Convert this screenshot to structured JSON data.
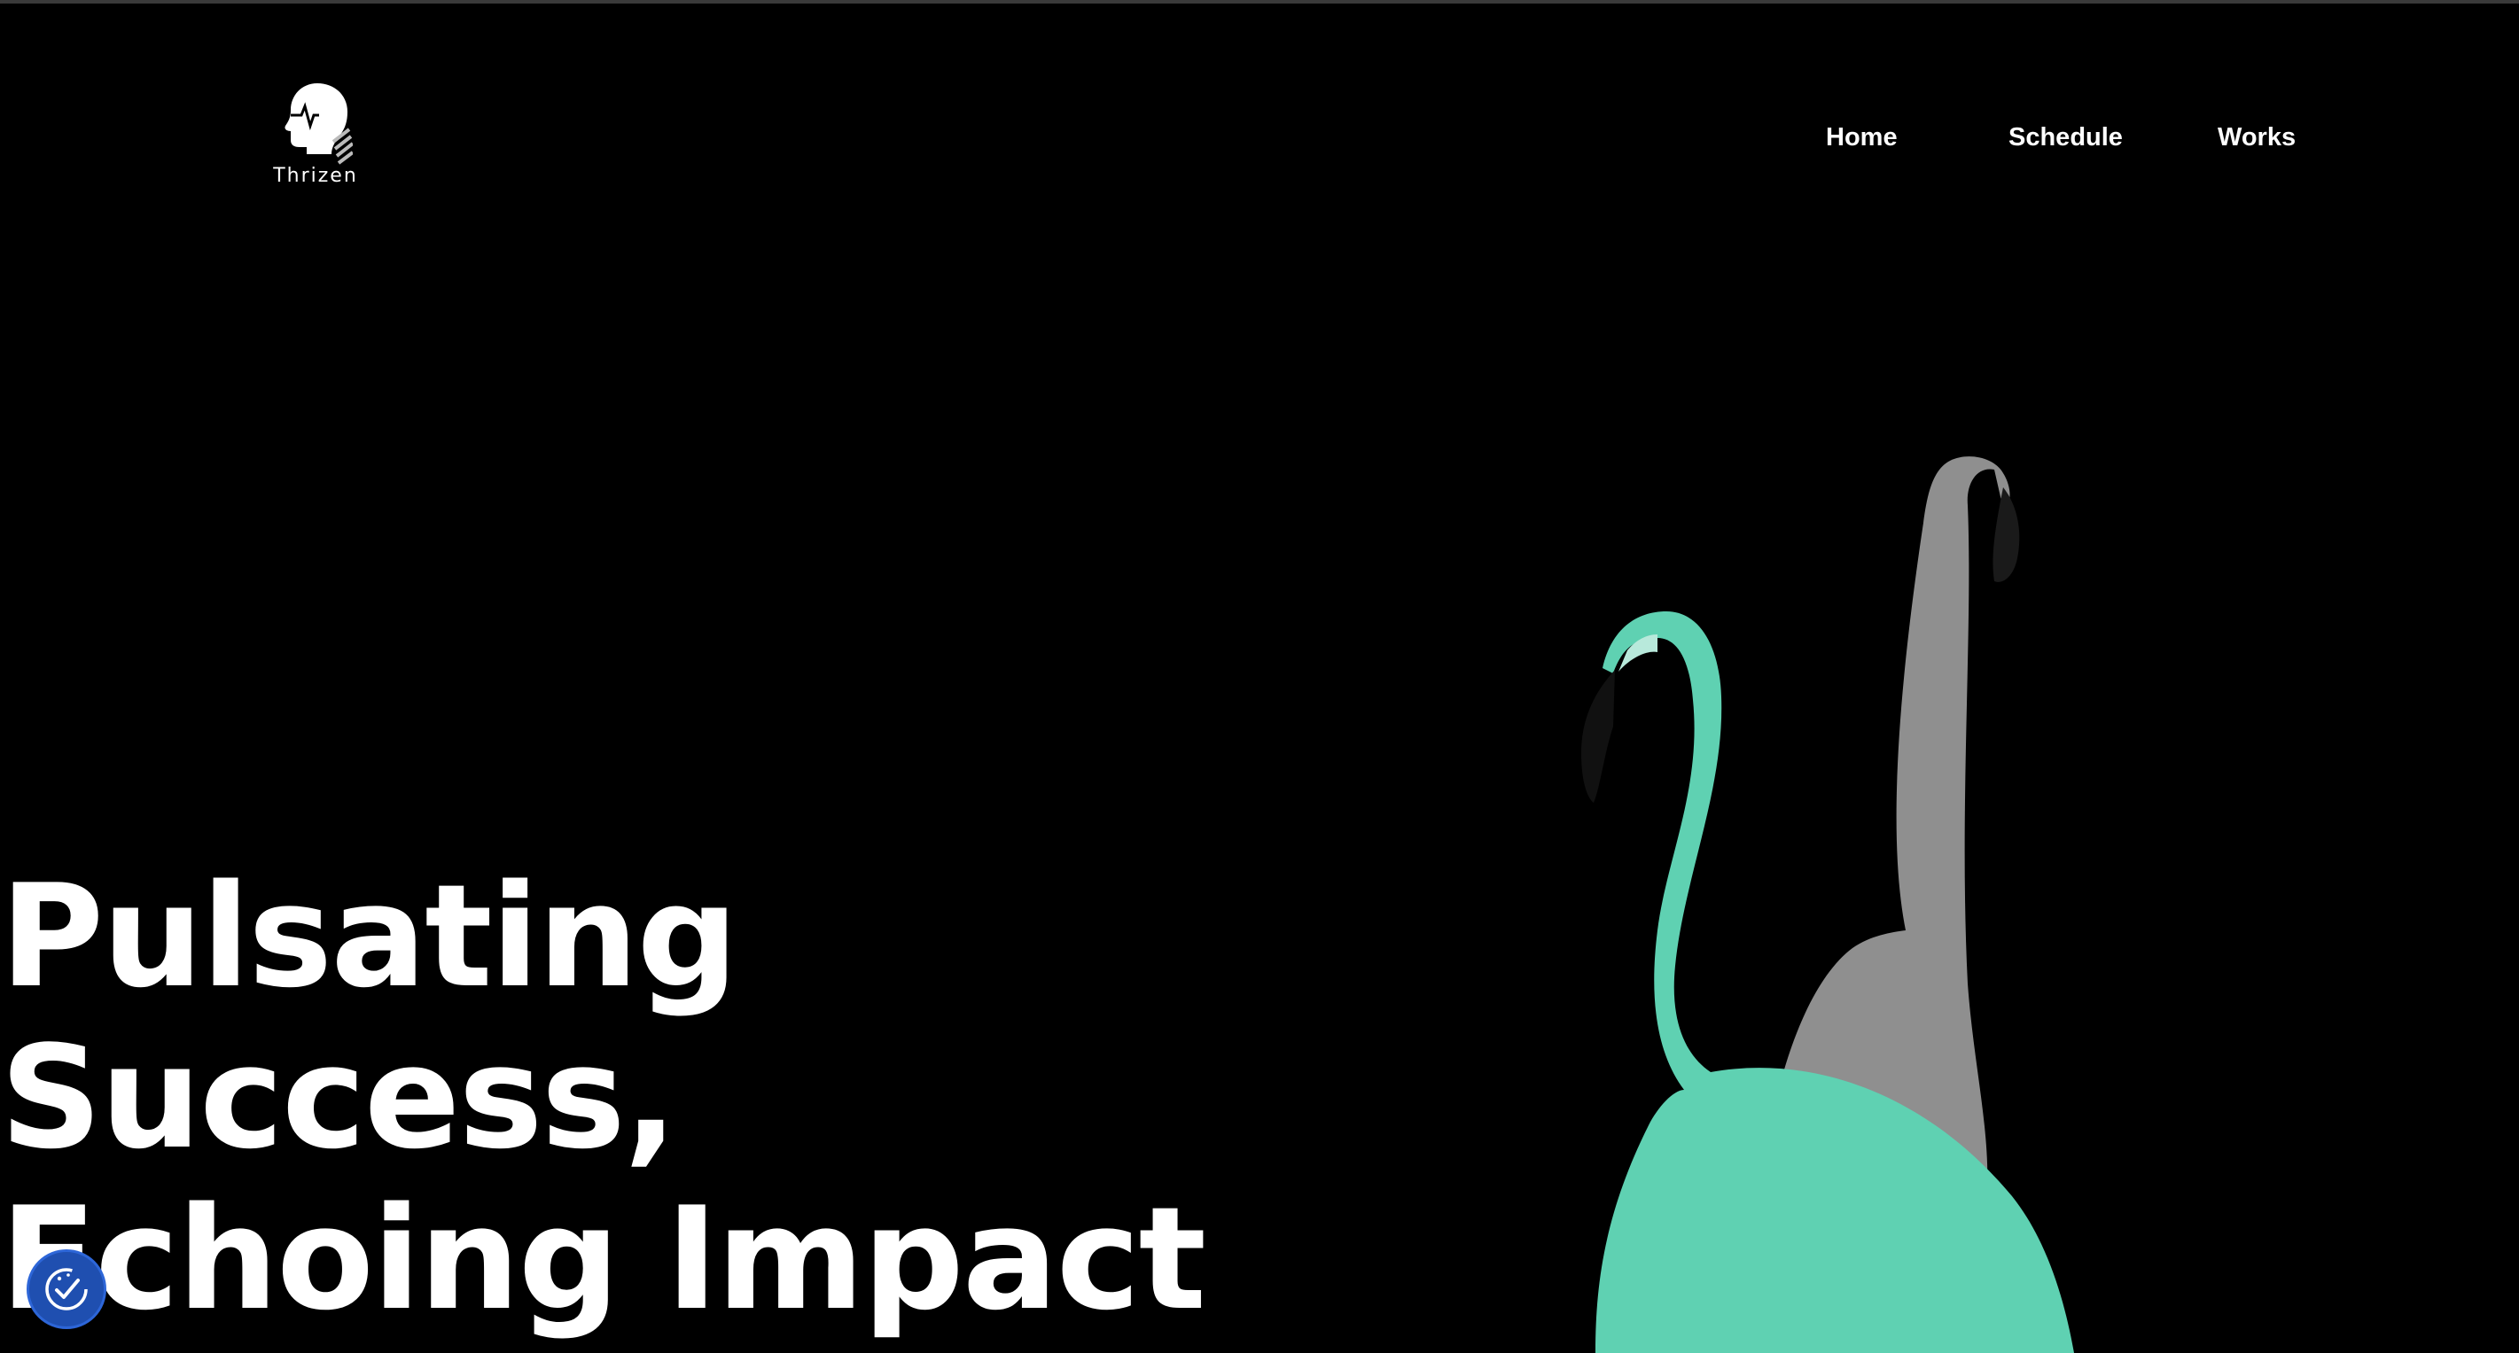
{
  "brand": {
    "name": "Thrizen",
    "logo_icon": "head-idea-icon"
  },
  "nav": {
    "items": [
      {
        "label": "Home"
      },
      {
        "label": "Schedule"
      },
      {
        "label": "Works"
      }
    ]
  },
  "hero": {
    "title_lines": [
      "Pulsating",
      "Success,",
      "Echoing Impact"
    ]
  },
  "colors": {
    "background": "#000000",
    "text": "#ffffff",
    "flamingo_teal": "#5fd1b2",
    "flamingo_gray": "#9a9a9a",
    "cookie_button": "#1f4fb0"
  },
  "cookie_consent": {
    "icon": "cookie-check-icon"
  }
}
